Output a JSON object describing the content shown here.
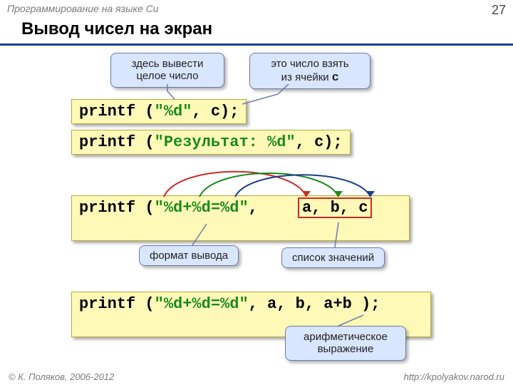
{
  "header": {
    "subject": "Программирование на языке Си",
    "page_number": "27"
  },
  "title": "Вывод чисел на экран",
  "callouts": {
    "c1_line1": "здесь вывести",
    "c1_line2": "целое число",
    "c2_line1": "это число взять",
    "c2_line2_pre": "из ячейки ",
    "c2_line2_var": "c",
    "c3": "формат вывода",
    "c4": "список значений",
    "c5_line1": "арифметическое",
    "c5_line2": "выражение"
  },
  "code": {
    "line1_a": "printf (",
    "line1_b": "\"%d\"",
    "line1_c": ", c);",
    "line2_a": "printf (",
    "line2_b": "\"Результат: %d\"",
    "line2_c": ", c);",
    "line3_a": "printf (",
    "line3_b": "\"%d+%d=%d\"",
    "line3_c": ", ",
    "line3_close": " );",
    "line3_args": "a, b, c",
    "line4_a": "printf (",
    "line4_b": "\"%d+%d=%d\"",
    "line4_c": ", a, b, a+b );"
  },
  "footer": {
    "copyright": "© К. Поляков, 2006-2012",
    "url": "http://kpolyakov.narod.ru"
  }
}
